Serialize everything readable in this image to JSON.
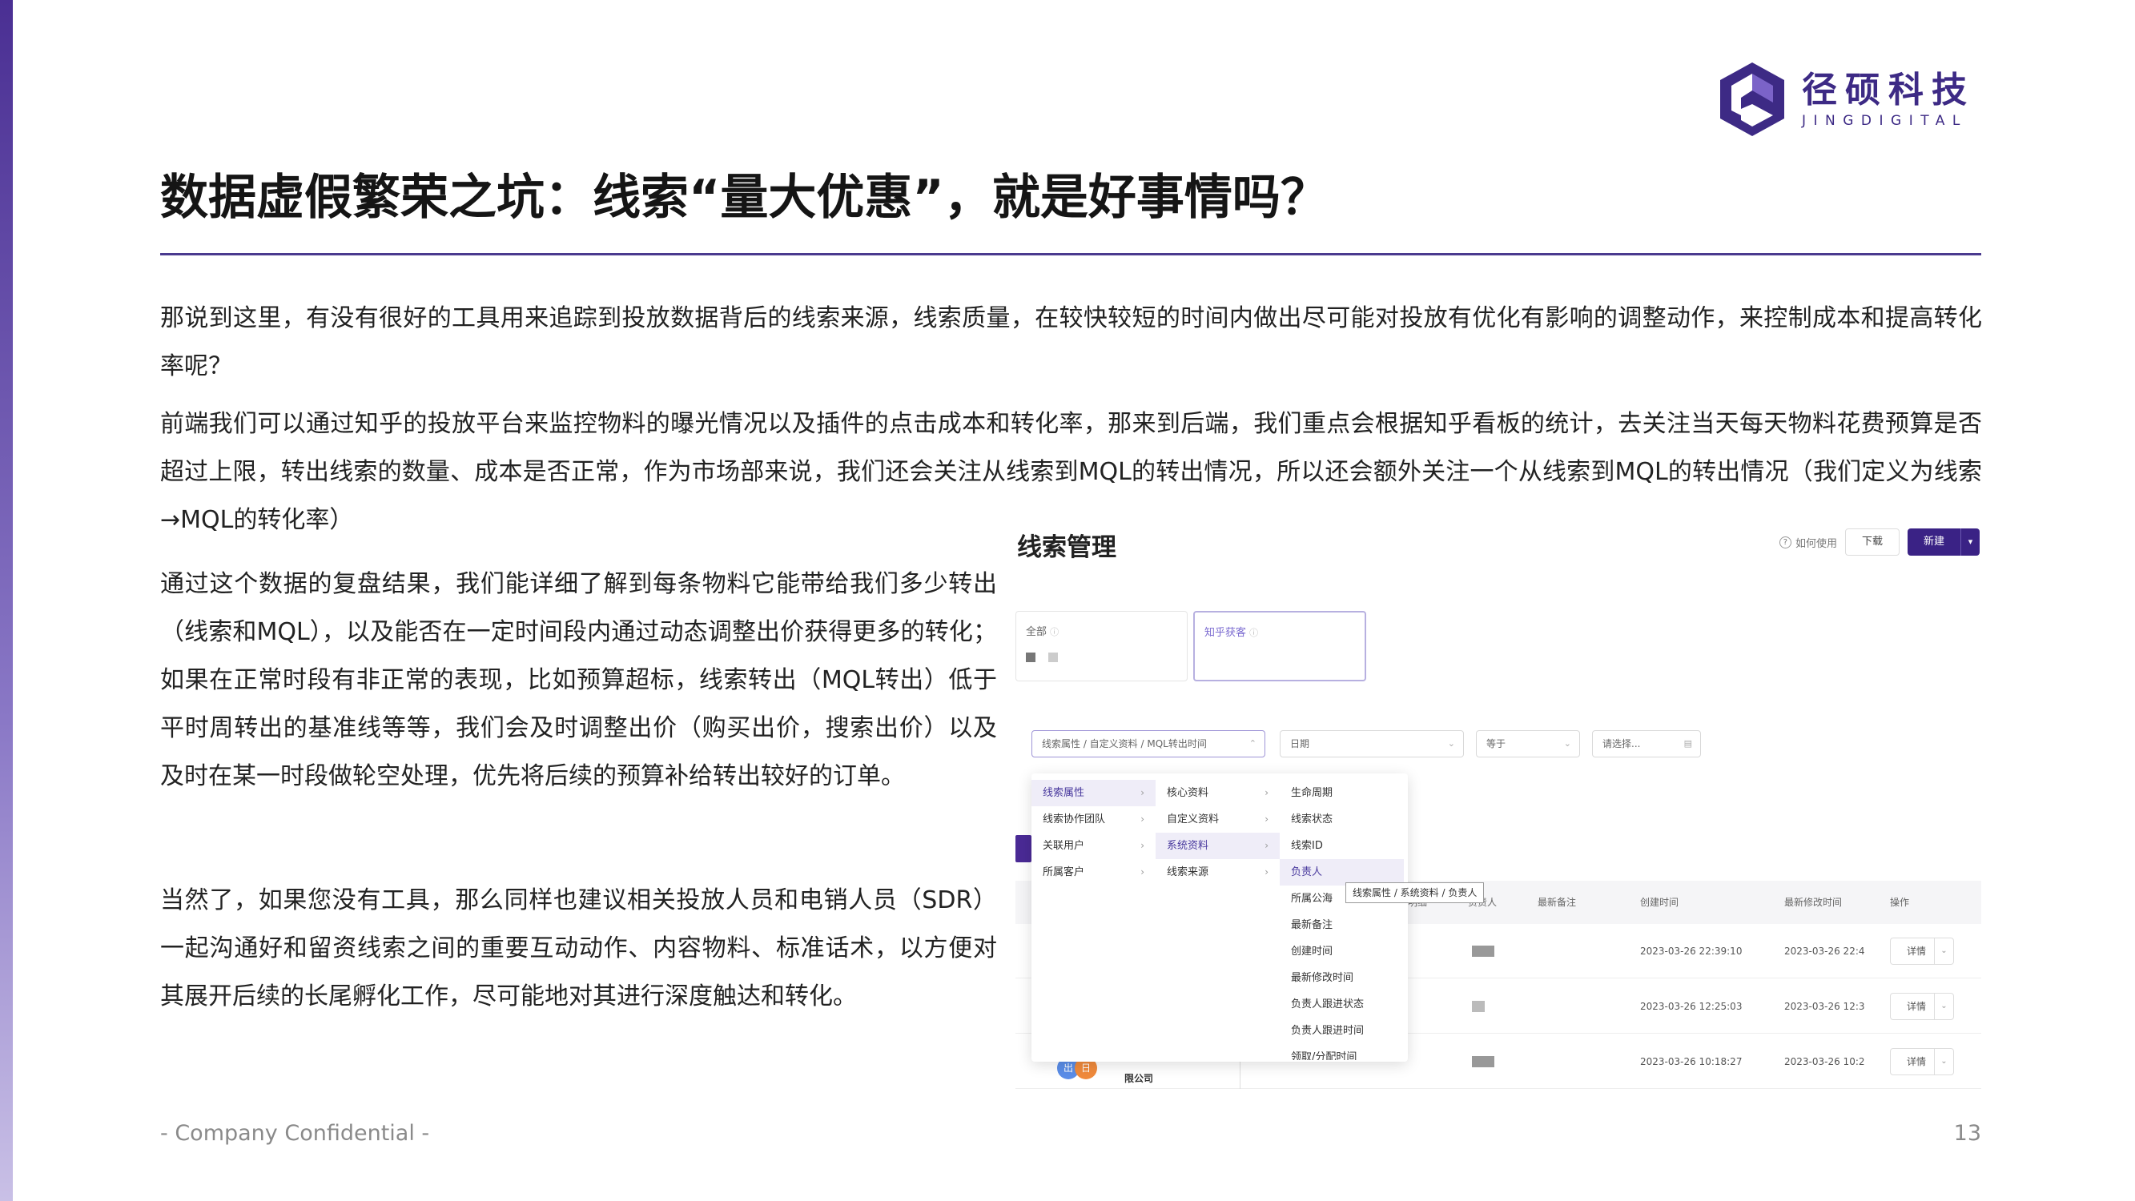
{
  "brand": {
    "name_cn": "径硕科技",
    "name_en": "JINGDIGITAL",
    "color": "#3d2a85",
    "accent": "#4a2f93"
  },
  "slide": {
    "title": "数据虚假繁荣之坑：线索“量大优惠”，就是好事情吗？",
    "paragraphs": [
      "那说到这里，有没有很好的工具用来追踪到投放数据背后的线索来源，线索质量，在较快较短的时间内做出尽可能对投放有优化有影响的调整动作，来控制成本和提高转化率呢？",
      "前端我们可以通过知乎的投放平台来监控物料的曝光情况以及插件的点击成本和转化率，那来到后端，我们重点会根据知乎看板的统计，去关注当天每天物料花费预算是否超过上限，转出线索的数量、成本是否正常，作为市场部来说，我们还会关注从线索到MQL的转出情况，所以还会额外关注一个从线索到MQL的转出情况（我们定义为线索→MQL的转化率）",
      "通过这个数据的复盘结果，我们能详细了解到每条物料它能带给我们多少转出（线索和MQL），以及能否在一定时间段内通过动态调整出价获得更多的转化；如果在正常时段有非正常的表现，比如预算超标，线索转出（MQL转出）低于平时周转出的基准线等等，我们会及时调整出价（购买出价，搜索出价）以及及时在某一时段做轮空处理，优先将后续的预算补给转出较好的订单。",
      "当然了，如果您没有工具，那么同样也建议相关投放人员和电销人员（SDR）一起沟通好和留资线索之间的重要互动动作、内容物料、标准话术，以方便对其展开后续的长尾孵化工作，尽可能地对其进行深度触达和转化。"
    ],
    "footer": "- Company Confidential -",
    "page_number": "13"
  },
  "screenshot": {
    "title": "线索管理",
    "help": "如何使用",
    "download": "下载",
    "new": "新建",
    "cards": [
      {
        "label": "全部"
      },
      {
        "label": "知乎获客"
      }
    ],
    "filters": {
      "field": "线索属性 / 自定义资料 / MQL转出时间",
      "date": "日期",
      "op": "等于",
      "pick": "请选择..."
    },
    "menu": {
      "col1": [
        "线索属性",
        "线索协作团队",
        "关联用户",
        "所属客户"
      ],
      "col2": [
        "核心资料",
        "自定义资料",
        "系统资料",
        "线索来源"
      ],
      "col3": [
        "生命周期",
        "线索状态",
        "线索ID",
        "负责人",
        "所属公海",
        "最新备注",
        "创建时间",
        "最新修改时间",
        "负责人跟进状态",
        "负责人跟进时间",
        "领取/分配时间"
      ]
    },
    "tooltip": "线索属性 / 系统资料 / 负责人",
    "table": {
      "headers": [
        "明细",
        "负责人",
        "最新备注",
        "创建时间",
        "最新修改时间",
        "操作"
      ],
      "rows": [
        {
          "created": "2023-03-26 22:39:10",
          "modified": "2023-03-26 22:4",
          "action": "详情"
        },
        {
          "created": "2023-03-26 12:25:03",
          "modified": "2023-03-26 12:3",
          "action": "详情"
        },
        {
          "created": "2023-03-26 10:18:27",
          "modified": "2023-03-26 10:2",
          "action": "详情"
        }
      ]
    },
    "company_suffix": "限公司",
    "avatars": [
      "出",
      "日"
    ]
  }
}
